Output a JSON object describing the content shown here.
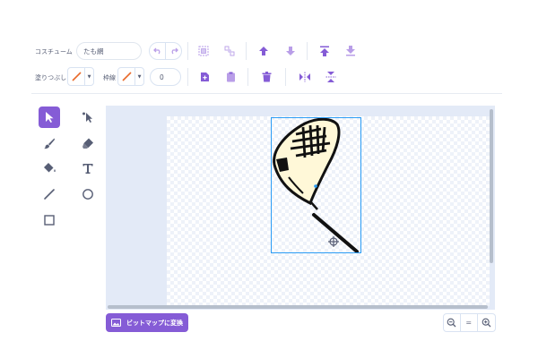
{
  "toolbar": {
    "costume_label": "コスチューム",
    "costume_name": "たも網",
    "fill_label": "塗りつぶし",
    "outline_label": "枠線",
    "outline_width": "0",
    "icons": [
      "undo-icon",
      "redo-icon",
      "group-icon",
      "ungroup-icon",
      "forward-icon",
      "backward-icon",
      "front-icon",
      "back-icon",
      "copy-icon",
      "paste-icon",
      "delete-icon",
      "flip-horizontal-icon",
      "flip-vertical-icon"
    ]
  },
  "tools": [
    "select-tool",
    "reshape-tool",
    "brush-tool",
    "eraser-tool",
    "fill-tool",
    "text-tool",
    "line-tool",
    "circle-tool",
    "rectangle-tool"
  ],
  "bottom": {
    "convert_label": "ビットマップに変換",
    "zoom_reset_label": "="
  },
  "colors": {
    "accent": "#855cd6",
    "accent_light": "#b99ee8",
    "text": "#575e75",
    "selection": "#2a9cf5",
    "net_fill": "#fff8d8",
    "swatch_slash": "#e86a2b"
  }
}
